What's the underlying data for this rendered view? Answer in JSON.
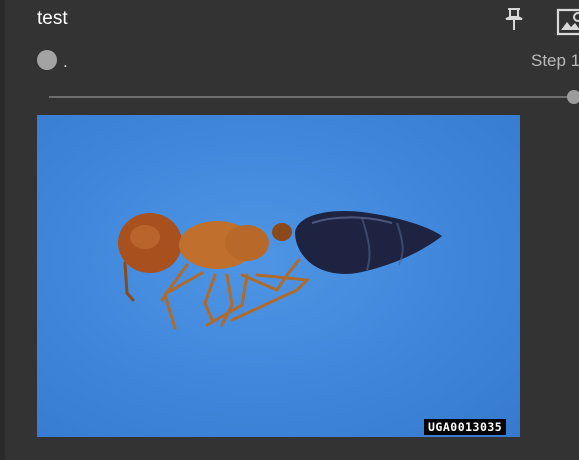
{
  "card": {
    "title": "test",
    "run_name": ".",
    "run_color": "#a3a3a3",
    "step_label": "Step 1"
  },
  "image": {
    "watermark": "UGA0013035"
  },
  "icons": {
    "pin": "pin-icon",
    "image_settings": "image-settings-icon"
  },
  "slider": {
    "value_fraction": 1.0
  }
}
